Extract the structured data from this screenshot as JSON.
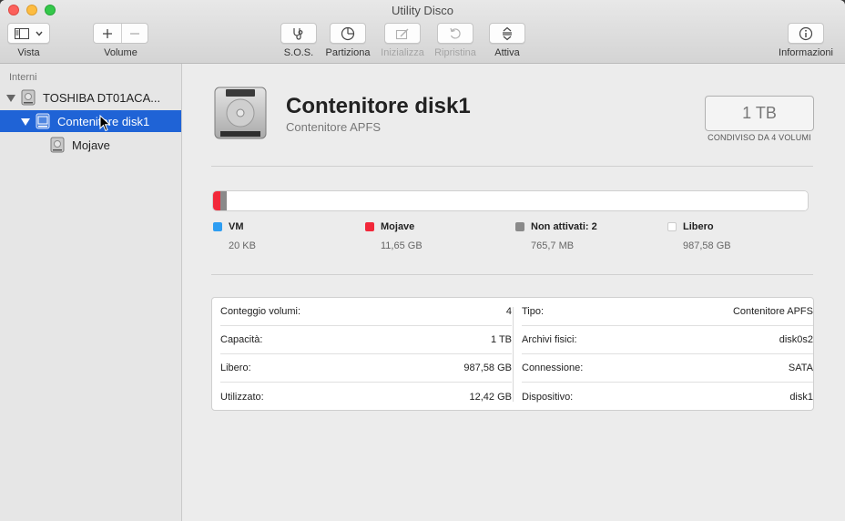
{
  "window": {
    "title": "Utility Disco"
  },
  "toolbar": {
    "vista_label": "Vista",
    "volume_label": "Volume",
    "sos_label": "S.O.S.",
    "partiziona_label": "Partiziona",
    "inizializza_label": "Inizializza",
    "ripristina_label": "Ripristina",
    "attiva_label": "Attiva",
    "informazioni_label": "Informazioni"
  },
  "sidebar": {
    "section_label": "Interni",
    "items": [
      {
        "label": "TOSHIBA DT01ACA..."
      },
      {
        "label": "Contenitore disk1"
      },
      {
        "label": "Mojave"
      }
    ]
  },
  "disk": {
    "title": "Contenitore disk1",
    "subtitle": "Contenitore APFS",
    "capacity": "1 TB",
    "capacity_caption": "CONDIVISO DA 4 VOLUMI"
  },
  "usage": {
    "legend": [
      {
        "name": "VM",
        "value": "20 KB",
        "color": "#2d9df2",
        "fraction": 0.0
      },
      {
        "name": "Mojave",
        "value": "11,65 GB",
        "color": "#f2283a",
        "fraction": 0.0117
      },
      {
        "name": "Non attivati: 2",
        "value": "765,7 MB",
        "color": "#8a8a8a",
        "fraction": 0.0008
      },
      {
        "name": "Libero",
        "value": "987,58 GB",
        "color": "#ffffff",
        "fraction": 0.9875
      }
    ]
  },
  "info": {
    "left": [
      {
        "label": "Conteggio volumi:",
        "value": "4"
      },
      {
        "label": "Capacità:",
        "value": "1 TB"
      },
      {
        "label": "Libero:",
        "value": "987,58 GB"
      },
      {
        "label": "Utilizzato:",
        "value": "12,42 GB"
      }
    ],
    "right": [
      {
        "label": "Tipo:",
        "value": "Contenitore APFS"
      },
      {
        "label": "Archivi fisici:",
        "value": "disk0s2"
      },
      {
        "label": "Connessione:",
        "value": "SATA"
      },
      {
        "label": "Dispositivo:",
        "value": "disk1"
      }
    ]
  },
  "colors": {
    "selection": "#1f63d6",
    "mojave": "#f2283a",
    "vm": "#2d9df2",
    "inactive": "#8a8a8a"
  }
}
